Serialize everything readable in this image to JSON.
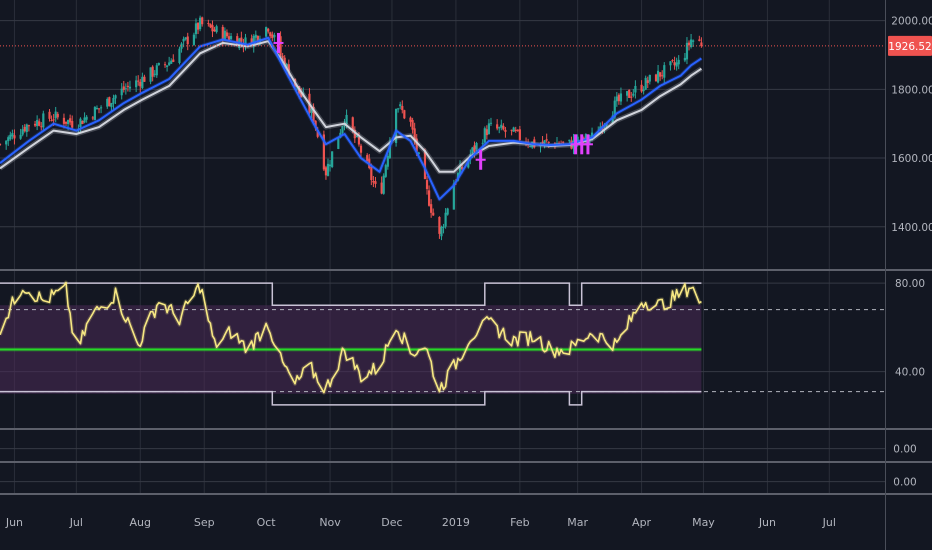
{
  "chart_data": [
    {
      "type": "candlestick",
      "panel": "price",
      "x_axis": {
        "tick_labels": [
          "Jun",
          "Jul",
          "Aug",
          "Sep",
          "Oct",
          "Nov",
          "Dec",
          "2019",
          "Feb",
          "Mar",
          "Apr",
          "May",
          "Jun",
          "Jul"
        ],
        "range": [
          "2018-05-25",
          "2019-07-28"
        ]
      },
      "y_axis": {
        "tick_labels": [
          "2000.00",
          "1800.00",
          "1600.00",
          "1400.00"
        ],
        "ylim": [
          1280,
          2060
        ],
        "position": "right"
      },
      "last_price": {
        "value": 1926.52,
        "label": "1926.52",
        "color": "#ef5350"
      },
      "series": [
        {
          "kind": "ohlc",
          "up_color": "#26a69a",
          "down_color": "#ef5350",
          "close_points": [
            [
              "2018-05-25",
              1640
            ],
            [
              "2018-06-08",
              1700
            ],
            [
              "2018-06-20",
              1720
            ],
            [
              "2018-07-01",
              1700
            ],
            [
              "2018-07-12",
              1745
            ],
            [
              "2018-07-24",
              1800
            ],
            [
              "2018-08-02",
              1830
            ],
            [
              "2018-08-15",
              1880
            ],
            [
              "2018-08-30",
              1990
            ],
            [
              "2018-09-10",
              1960
            ],
            [
              "2018-09-22",
              1935
            ],
            [
              "2018-10-02",
              1985
            ],
            [
              "2018-10-08",
              1900
            ],
            [
              "2018-10-16",
              1800
            ],
            [
              "2018-10-24",
              1720
            ],
            [
              "2018-10-30",
              1560
            ],
            [
              "2018-11-08",
              1720
            ],
            [
              "2018-11-16",
              1620
            ],
            [
              "2018-11-25",
              1480
            ],
            [
              "2018-12-03",
              1760
            ],
            [
              "2018-12-10",
              1700
            ],
            [
              "2018-12-17",
              1520
            ],
            [
              "2018-12-24",
              1370
            ],
            [
              "2018-12-31",
              1530
            ],
            [
              "2019-01-08",
              1610
            ],
            [
              "2019-01-17",
              1690
            ],
            [
              "2019-01-29",
              1670
            ],
            [
              "2019-02-08",
              1640
            ],
            [
              "2019-02-16",
              1645
            ],
            [
              "2019-02-25",
              1640
            ],
            [
              "2019-03-08",
              1660
            ],
            [
              "2019-03-20",
              1760
            ],
            [
              "2019-04-01",
              1810
            ],
            [
              "2019-04-10",
              1845
            ],
            [
              "2019-04-20",
              1880
            ],
            [
              "2019-04-25",
              1945
            ],
            [
              "2019-04-30",
              1935
            ]
          ]
        },
        {
          "kind": "line",
          "color": "#2962ff",
          "points": [
            [
              "2018-05-25",
              1585
            ],
            [
              "2018-06-08",
              1650
            ],
            [
              "2018-06-20",
              1700
            ],
            [
              "2018-07-01",
              1680
            ],
            [
              "2018-07-12",
              1710
            ],
            [
              "2018-07-24",
              1760
            ],
            [
              "2018-08-02",
              1790
            ],
            [
              "2018-08-15",
              1830
            ],
            [
              "2018-08-30",
              1925
            ],
            [
              "2018-09-10",
              1945
            ],
            [
              "2018-09-22",
              1930
            ],
            [
              "2018-10-02",
              1950
            ],
            [
              "2018-10-08",
              1880
            ],
            [
              "2018-10-16",
              1790
            ],
            [
              "2018-10-24",
              1700
            ],
            [
              "2018-10-30",
              1640
            ],
            [
              "2018-11-08",
              1670
            ],
            [
              "2018-11-16",
              1600
            ],
            [
              "2018-11-25",
              1560
            ],
            [
              "2018-12-03",
              1680
            ],
            [
              "2018-12-10",
              1650
            ],
            [
              "2018-12-17",
              1570
            ],
            [
              "2018-12-24",
              1480
            ],
            [
              "2018-12-31",
              1520
            ],
            [
              "2019-01-08",
              1600
            ],
            [
              "2019-01-17",
              1650
            ],
            [
              "2019-01-29",
              1650
            ],
            [
              "2019-02-08",
              1640
            ],
            [
              "2019-02-16",
              1638
            ],
            [
              "2019-02-25",
              1640
            ],
            [
              "2019-03-08",
              1660
            ],
            [
              "2019-03-20",
              1730
            ],
            [
              "2019-04-01",
              1770
            ],
            [
              "2019-04-10",
              1810
            ],
            [
              "2019-04-20",
              1840
            ],
            [
              "2019-04-25",
              1870
            ],
            [
              "2019-04-30",
              1890
            ]
          ]
        },
        {
          "kind": "line",
          "color": "#d1d4dc",
          "points": [
            [
              "2018-05-25",
              1570
            ],
            [
              "2018-06-08",
              1630
            ],
            [
              "2018-06-20",
              1680
            ],
            [
              "2018-07-01",
              1670
            ],
            [
              "2018-07-12",
              1690
            ],
            [
              "2018-07-24",
              1740
            ],
            [
              "2018-08-02",
              1770
            ],
            [
              "2018-08-15",
              1810
            ],
            [
              "2018-08-30",
              1905
            ],
            [
              "2018-09-10",
              1935
            ],
            [
              "2018-09-22",
              1925
            ],
            [
              "2018-10-02",
              1940
            ],
            [
              "2018-10-08",
              1890
            ],
            [
              "2018-10-16",
              1810
            ],
            [
              "2018-10-24",
              1740
            ],
            [
              "2018-10-30",
              1690
            ],
            [
              "2018-11-08",
              1700
            ],
            [
              "2018-11-16",
              1660
            ],
            [
              "2018-11-25",
              1620
            ],
            [
              "2018-12-03",
              1660
            ],
            [
              "2018-12-10",
              1665
            ],
            [
              "2018-12-17",
              1620
            ],
            [
              "2018-12-24",
              1560
            ],
            [
              "2018-12-31",
              1560
            ],
            [
              "2019-01-08",
              1605
            ],
            [
              "2019-01-17",
              1635
            ],
            [
              "2019-01-29",
              1645
            ],
            [
              "2019-02-08",
              1640
            ],
            [
              "2019-02-16",
              1635
            ],
            [
              "2019-02-25",
              1638
            ],
            [
              "2019-03-08",
              1655
            ],
            [
              "2019-03-20",
              1710
            ],
            [
              "2019-04-01",
              1740
            ],
            [
              "2019-04-10",
              1780
            ],
            [
              "2019-04-20",
              1815
            ],
            [
              "2019-04-25",
              1840
            ],
            [
              "2019-04-30",
              1860
            ]
          ]
        }
      ],
      "markers": [
        {
          "x": "2018-10-07",
          "y": 1935,
          "color": "#e040fb"
        },
        {
          "x": "2019-01-13",
          "y": 1595,
          "color": "#e040fb"
        },
        {
          "x": "2019-02-28",
          "y": 1640,
          "color": "#e040fb"
        },
        {
          "x": "2019-03-03",
          "y": 1640,
          "color": "#e040fb"
        },
        {
          "x": "2019-03-06",
          "y": 1640,
          "color": "#e040fb"
        }
      ]
    },
    {
      "type": "line",
      "panel": "oscillator",
      "y_axis": {
        "tick_labels": [
          "80.00",
          "40.00"
        ],
        "ylim": [
          15,
          85
        ],
        "position": "right"
      },
      "band": {
        "upper": 70,
        "lower": 30,
        "color": "#4a2a55"
      },
      "dashed_levels": [
        68,
        31
      ],
      "midline": {
        "value": 50,
        "color": "#26d926"
      },
      "channel": {
        "upper": [
          [
            "2018-05-25",
            80
          ],
          [
            "2018-10-04",
            80
          ],
          [
            "2018-10-04",
            70
          ],
          [
            "2019-01-15",
            70
          ],
          [
            "2019-01-15",
            80
          ],
          [
            "2019-02-25",
            80
          ],
          [
            "2019-02-25",
            70
          ],
          [
            "2019-03-03",
            70
          ],
          [
            "2019-03-03",
            80
          ],
          [
            "2019-04-30",
            80
          ]
        ],
        "lower": [
          [
            "2018-05-25",
            31
          ],
          [
            "2018-10-04",
            31
          ],
          [
            "2018-10-04",
            25
          ],
          [
            "2019-01-15",
            25
          ],
          [
            "2019-01-15",
            31
          ],
          [
            "2019-02-25",
            31
          ],
          [
            "2019-02-25",
            25
          ],
          [
            "2019-03-03",
            25
          ],
          [
            "2019-03-03",
            31
          ],
          [
            "2019-04-30",
            31
          ]
        ]
      },
      "series": [
        {
          "color": "#f7e883",
          "points": [
            [
              "2018-05-25",
              60
            ],
            [
              "2018-06-05",
              79
            ],
            [
              "2018-06-15",
              72
            ],
            [
              "2018-06-26",
              77
            ],
            [
              "2018-07-01",
              48
            ],
            [
              "2018-07-08",
              65
            ],
            [
              "2018-07-20",
              75
            ],
            [
              "2018-07-31",
              52
            ],
            [
              "2018-08-10",
              72
            ],
            [
              "2018-08-20",
              64
            ],
            [
              "2018-08-30",
              79
            ],
            [
              "2018-09-06",
              52
            ],
            [
              "2018-09-14",
              58
            ],
            [
              "2018-09-22",
              50
            ],
            [
              "2018-10-02",
              62
            ],
            [
              "2018-10-08",
              45
            ],
            [
              "2018-10-15",
              34
            ],
            [
              "2018-10-22",
              42
            ],
            [
              "2018-10-30",
              32
            ],
            [
              "2018-11-08",
              50
            ],
            [
              "2018-11-16",
              38
            ],
            [
              "2018-11-25",
              42
            ],
            [
              "2018-12-03",
              62
            ],
            [
              "2018-12-10",
              48
            ],
            [
              "2018-12-17",
              52
            ],
            [
              "2018-12-24",
              32
            ],
            [
              "2018-12-31",
              42
            ],
            [
              "2019-01-08",
              56
            ],
            [
              "2019-01-17",
              62
            ],
            [
              "2019-01-29",
              54
            ],
            [
              "2019-02-08",
              56
            ],
            [
              "2019-02-16",
              50
            ],
            [
              "2019-02-25",
              50
            ],
            [
              "2019-03-08",
              58
            ],
            [
              "2019-03-20",
              52
            ],
            [
              "2019-04-01",
              72
            ],
            [
              "2019-04-10",
              70
            ],
            [
              "2019-04-20",
              75
            ],
            [
              "2019-04-25",
              79
            ],
            [
              "2019-04-30",
              69
            ]
          ]
        }
      ]
    },
    {
      "type": "line",
      "panel": "sub-1",
      "y_axis": {
        "tick_labels": [
          "0.00"
        ]
      }
    },
    {
      "type": "line",
      "panel": "sub-2",
      "y_axis": {
        "tick_labels": [
          "0.00"
        ]
      }
    }
  ]
}
